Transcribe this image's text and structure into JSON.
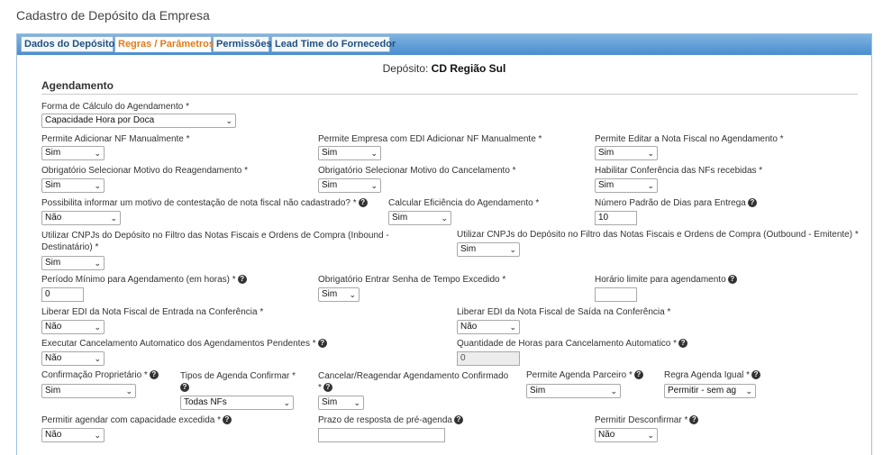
{
  "page_title": "Cadastro de Depósito da Empresa",
  "tabs": [
    {
      "label": "Dados do Depósito"
    },
    {
      "label": "Regras / Parâmetros"
    },
    {
      "label": "Permissões"
    },
    {
      "label": "Lead Time do Fornecedor"
    }
  ],
  "depot": {
    "label": "Depósito:",
    "name": "CD Região Sul"
  },
  "section_title": "Agendamento",
  "help_glyph": "?",
  "chevron": "⌄",
  "fields": {
    "forma_calculo": {
      "label": "Forma de Cálculo do Agendamento *",
      "value": "Capacidade Hora por Doca"
    },
    "adicionar_nf": {
      "label": "Permite Adicionar NF Manualmente *",
      "value": "Sim"
    },
    "empresa_edi": {
      "label": "Permite Empresa com EDI Adicionar NF Manualmente *",
      "value": "Sim"
    },
    "editar_nf": {
      "label": "Permite Editar a Nota Fiscal no Agendamento *",
      "value": "Sim"
    },
    "motivo_reagend": {
      "label": "Obrigatório Selecionar Motivo do Reagendamento *",
      "value": "Sim"
    },
    "motivo_cancel": {
      "label": "Obrigatório Selecionar Motivo do Cancelamento *",
      "value": "Sim"
    },
    "conferencia_nfs": {
      "label": "Habilitar Conferência das NFs recebidas *",
      "value": "Sim"
    },
    "contestacao": {
      "label": "Possibilita informar um motivo de contestação de nota fiscal não cadastrado? *",
      "value": "Não"
    },
    "eficiencia": {
      "label": "Calcular Eficiência do Agendamento *",
      "value": "Sim"
    },
    "dias_entrega": {
      "label": "Número Padrão de Dias para Entrega",
      "value": "10"
    },
    "cnpj_inbound": {
      "label": "Utilizar CNPJs do Depósito no Filtro das Notas Fiscais e Ordens de Compra (Inbound - Destinatário) *",
      "value": "Sim"
    },
    "cnpj_outbound": {
      "label": "Utilizar CNPJs do Depósito no Filtro das Notas Fiscais e Ordens de Compra (Outbound - Emitente) *",
      "value": "Sim"
    },
    "periodo_minimo": {
      "label": "Período Mínimo para Agendamento (em horas) *",
      "value": "0"
    },
    "senha_tempo": {
      "label": "Obrigatório Entrar Senha de Tempo Excedido *",
      "value": "Sim"
    },
    "horario_limite": {
      "label": "Horário limite para agendamento",
      "value": ""
    },
    "edi_entrada": {
      "label": "Liberar EDI da Nota Fiscal de Entrada na Conferência *",
      "value": "Não"
    },
    "edi_saida": {
      "label": "Liberar EDI da Nota Fiscal de Saída na Conferência *",
      "value": "Não"
    },
    "cancel_auto": {
      "label": "Executar Cancelamento Automatico dos Agendamentos Pendentes *",
      "value": "Não"
    },
    "horas_cancel": {
      "label": "Quantidade de Horas para Cancelamento Automatico *",
      "value": "0"
    },
    "conf_proprietario": {
      "label": "Confirmação Proprietário *",
      "value": "Sim"
    },
    "tipos_agenda": {
      "label": "Tipos de Agenda Confirmar *",
      "value": "Todas NFs"
    },
    "cancelar_reagendar": {
      "label": "Cancelar/Reagendar Agendamento Confirmado *",
      "value": "Sim"
    },
    "agenda_parceiro": {
      "label": "Permite Agenda Parceiro *",
      "value": "Sim"
    },
    "regra_agenda": {
      "label": "Regra Agenda Igual *",
      "value": "Permitir - sem ag"
    },
    "capacidade_excedida": {
      "label": "Permitir agendar com capacidade excedida *",
      "value": "Não"
    },
    "prazo_resposta": {
      "label": "Prazo de resposta de pré-agenda",
      "value": ""
    },
    "desconfirmar": {
      "label": "Permitir Desconfirmar *",
      "value": "Não"
    }
  }
}
